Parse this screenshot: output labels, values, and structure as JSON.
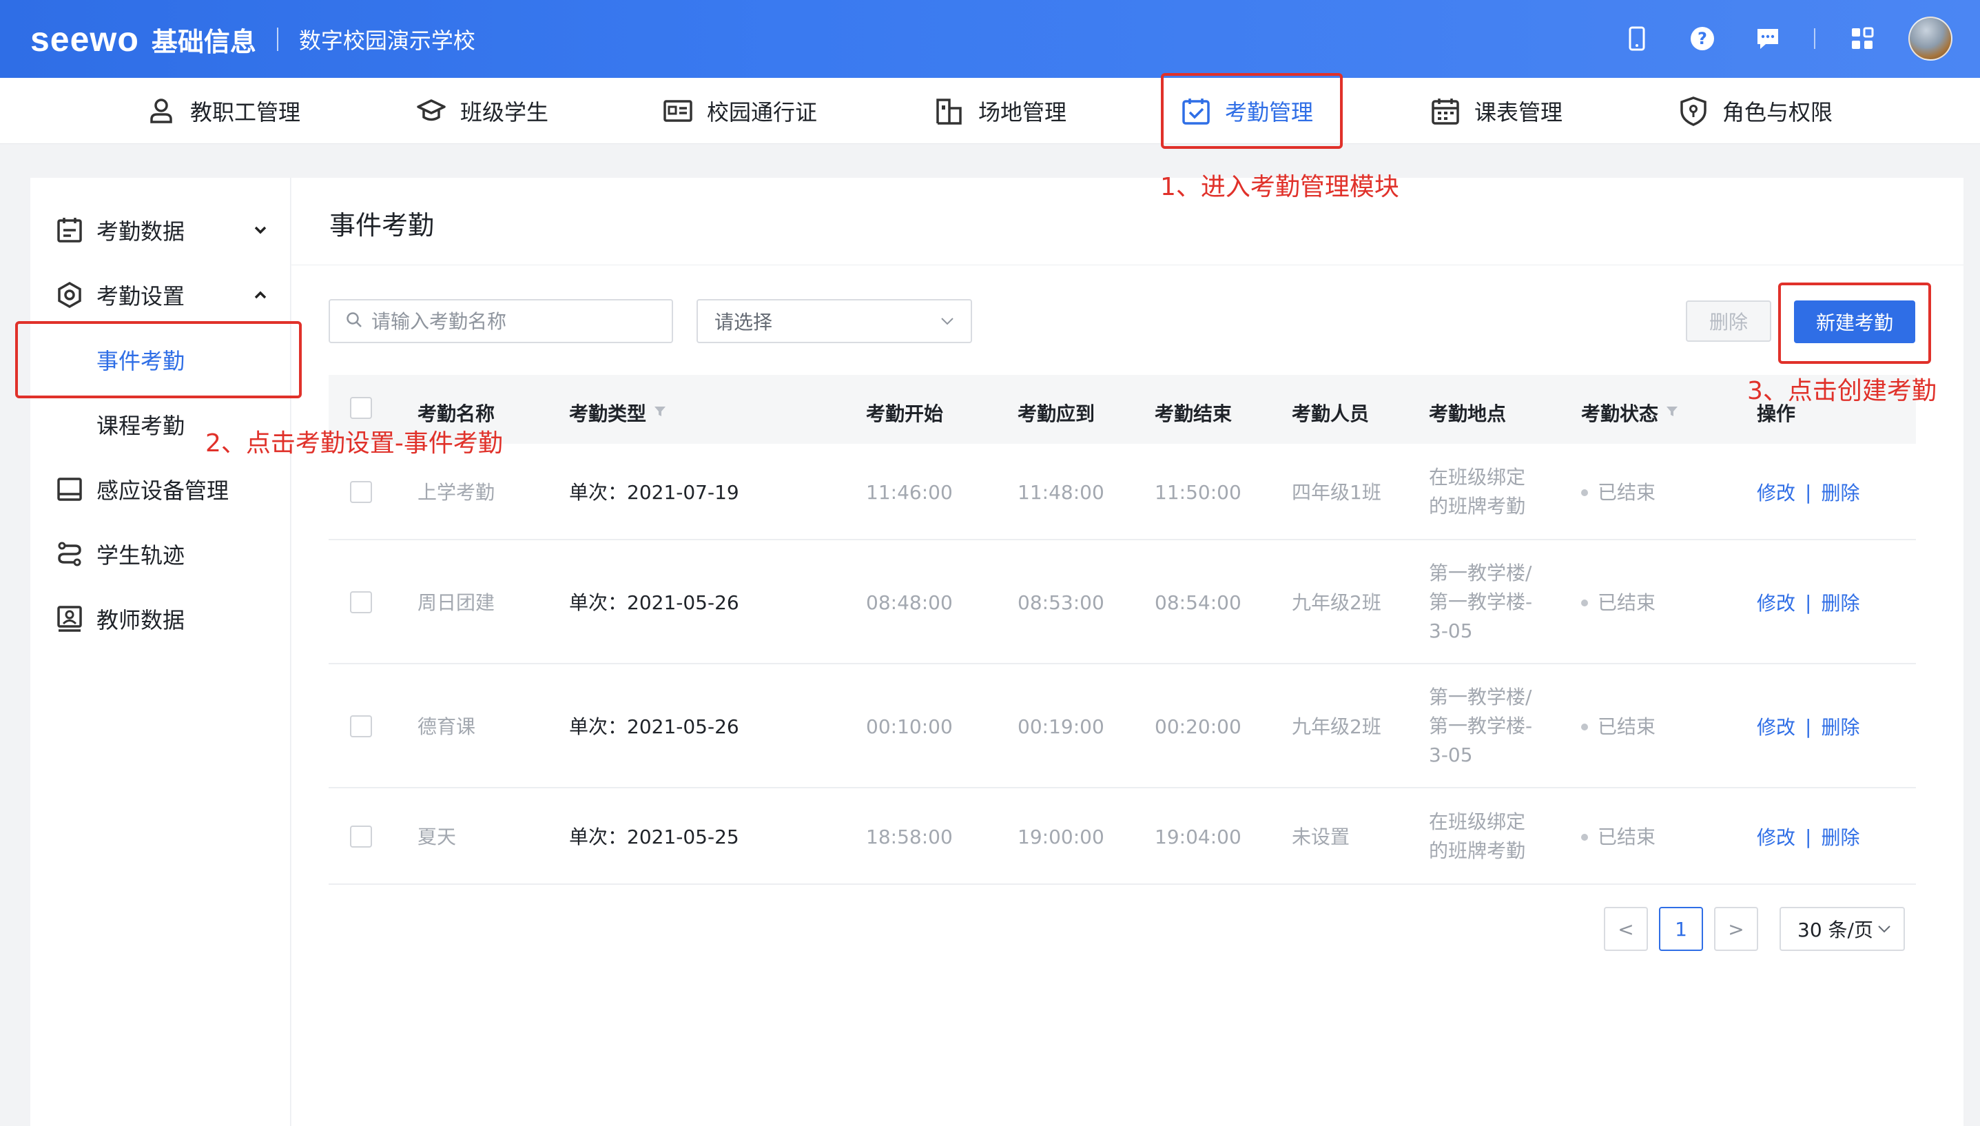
{
  "header": {
    "logo": "seewo",
    "product": "基础信息",
    "school": "数字校园演示学校"
  },
  "modules": [
    {
      "label": "教职工管理",
      "icon": "person-icon"
    },
    {
      "label": "班级学生",
      "icon": "graduation-cap-icon"
    },
    {
      "label": "校园通行证",
      "icon": "id-card-icon"
    },
    {
      "label": "场地管理",
      "icon": "building-icon"
    },
    {
      "label": "考勤管理",
      "icon": "calendar-check-icon",
      "active": true
    },
    {
      "label": "课表管理",
      "icon": "timetable-icon"
    },
    {
      "label": "角色与权限",
      "icon": "shield-icon"
    }
  ],
  "sidebar": {
    "items": [
      {
        "label": "考勤数据",
        "icon": "clipboard-icon"
      },
      {
        "label": "考勤设置",
        "icon": "settings-hex-icon"
      },
      {
        "label": "事件考勤",
        "active": true
      },
      {
        "label": "课程考勤"
      },
      {
        "label": "感应设备管理",
        "icon": "device-icon"
      },
      {
        "label": "学生轨迹",
        "icon": "route-icon"
      },
      {
        "label": "教师数据",
        "icon": "teacher-data-icon"
      }
    ]
  },
  "main": {
    "title": "事件考勤",
    "search_placeholder": "请输入考勤名称",
    "select_placeholder": "请选择",
    "delete_label": "删除",
    "new_label": "新建考勤"
  },
  "table": {
    "columns": [
      "考勤名称",
      "考勤类型",
      "考勤开始",
      "考勤应到",
      "考勤结束",
      "考勤人员",
      "考勤地点",
      "考勤状态",
      "操作"
    ],
    "rows": [
      {
        "name": "上学考勤",
        "type": "单次：2021-07-19",
        "start": "11:46:00",
        "due": "11:48:00",
        "end": "11:50:00",
        "people": "四年级1班",
        "location": "在班级绑定\n的班牌考勤",
        "status": "已结束",
        "edit": "修改",
        "del": "删除"
      },
      {
        "name": "周日团建",
        "type": "单次：2021-05-26",
        "start": "08:48:00",
        "due": "08:53:00",
        "end": "08:54:00",
        "people": "九年级2班",
        "location": "第一教学楼/\n第一教学楼-\n3-05",
        "status": "已结束",
        "edit": "修改",
        "del": "删除"
      },
      {
        "name": "德育课",
        "type": "单次：2021-05-26",
        "start": "00:10:00",
        "due": "00:19:00",
        "end": "00:20:00",
        "people": "九年级2班",
        "location": "第一教学楼/\n第一教学楼-\n3-05",
        "status": "已结束",
        "edit": "修改",
        "del": "删除"
      },
      {
        "name": "夏天",
        "type": "单次：2021-05-25",
        "start": "18:58:00",
        "due": "19:00:00",
        "end": "19:04:00",
        "people": "未设置",
        "location": "在班级绑定\n的班牌考勤",
        "status": "已结束",
        "edit": "修改",
        "del": "删除"
      }
    ]
  },
  "pagination": {
    "current": "1",
    "page_size": "30 条/页",
    "prev": "<",
    "next": ">"
  },
  "annotations": {
    "step1": "1、进入考勤管理模块",
    "step2": "2、点击考勤设置-事件考勤",
    "step3": "3、点击创建考勤"
  },
  "colors": {
    "accent": "#2f6ee6",
    "annotation": "#e0312a"
  }
}
